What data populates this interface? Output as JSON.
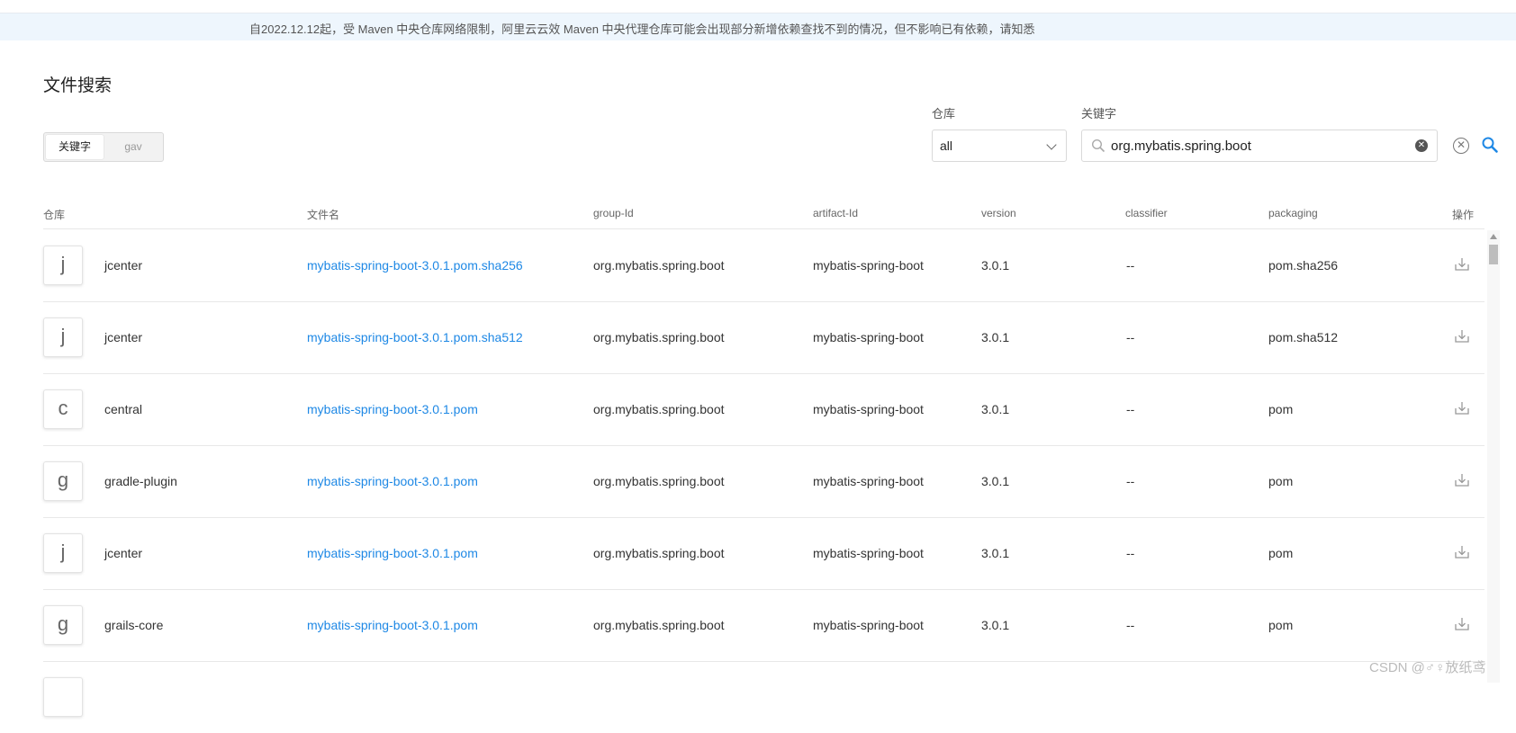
{
  "notice": "自2022.12.12起，受 Maven 中央仓库网络限制，阿里云云效 Maven 中央代理仓库可能会出现部分新增依赖查找不到的情况，但不影响已有依赖，请知悉",
  "title": "文件搜索",
  "search_mode": {
    "options": [
      "关键字",
      "gav"
    ],
    "active": "关键字"
  },
  "filters": {
    "repo_label": "仓库",
    "repo_value": "all",
    "keyword_label": "关键字",
    "keyword_value": "org.mybatis.spring.boot"
  },
  "icons": {
    "search": "search-icon",
    "clear": "clear-icon",
    "reset": "reset-icon",
    "download": "download-icon",
    "dropdown": "chevron-down-icon"
  },
  "accent_color": "#1e88e5",
  "table": {
    "headers": [
      "仓库",
      "文件名",
      "group-Id",
      "artifact-Id",
      "version",
      "classifier",
      "packaging",
      "操作"
    ],
    "rows": [
      {
        "avatar": "j",
        "repo": "jcenter",
        "file": "mybatis-spring-boot-3.0.1.pom.sha256",
        "group": "org.mybatis.spring.boot",
        "artifact": "mybatis-spring-boot",
        "version": "3.0.1",
        "classifier": "--",
        "packaging": "pom.sha256"
      },
      {
        "avatar": "j",
        "repo": "jcenter",
        "file": "mybatis-spring-boot-3.0.1.pom.sha512",
        "group": "org.mybatis.spring.boot",
        "artifact": "mybatis-spring-boot",
        "version": "3.0.1",
        "classifier": "--",
        "packaging": "pom.sha512"
      },
      {
        "avatar": "c",
        "repo": "central",
        "file": "mybatis-spring-boot-3.0.1.pom",
        "group": "org.mybatis.spring.boot",
        "artifact": "mybatis-spring-boot",
        "version": "3.0.1",
        "classifier": "--",
        "packaging": "pom"
      },
      {
        "avatar": "g",
        "repo": "gradle-plugin",
        "file": "mybatis-spring-boot-3.0.1.pom",
        "group": "org.mybatis.spring.boot",
        "artifact": "mybatis-spring-boot",
        "version": "3.0.1",
        "classifier": "--",
        "packaging": "pom"
      },
      {
        "avatar": "j",
        "repo": "jcenter",
        "file": "mybatis-spring-boot-3.0.1.pom",
        "group": "org.mybatis.spring.boot",
        "artifact": "mybatis-spring-boot",
        "version": "3.0.1",
        "classifier": "--",
        "packaging": "pom"
      },
      {
        "avatar": "g",
        "repo": "grails-core",
        "file": "mybatis-spring-boot-3.0.1.pom",
        "group": "org.mybatis.spring.boot",
        "artifact": "mybatis-spring-boot",
        "version": "3.0.1",
        "classifier": "--",
        "packaging": "pom"
      }
    ]
  },
  "watermark": "CSDN @♂♀放纸鸢"
}
